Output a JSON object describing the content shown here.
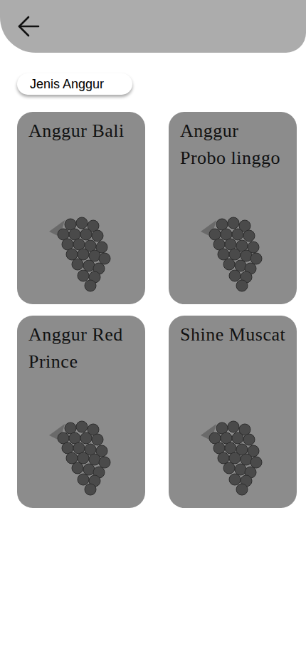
{
  "filter_chip": {
    "label": "Jenis Anggur"
  },
  "cards": [
    {
      "title": "Anggur Bali"
    },
    {
      "title": "Anggur Probo linggo"
    },
    {
      "title": "Anggur Red Prince"
    },
    {
      "title": "Shine Muscat"
    }
  ]
}
